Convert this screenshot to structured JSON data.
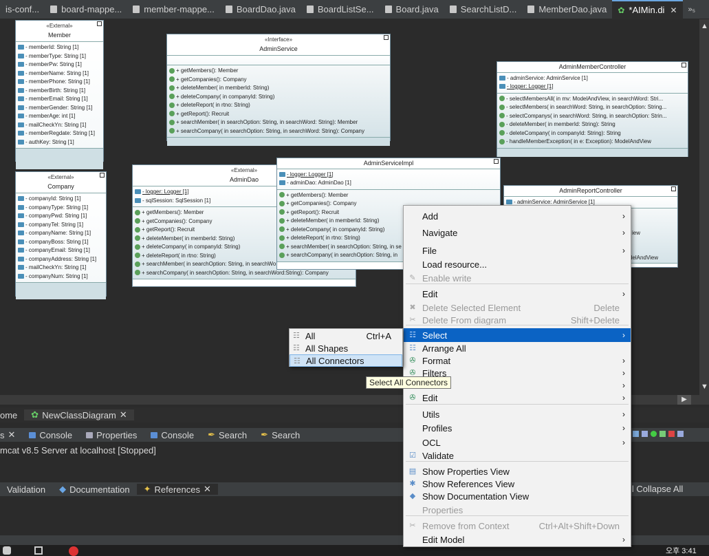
{
  "tabs": [
    {
      "label": "is-conf...",
      "active": false
    },
    {
      "label": "board-mappe...",
      "active": false
    },
    {
      "label": "member-mappe...",
      "active": false
    },
    {
      "label": "BoardDao.java",
      "active": false
    },
    {
      "label": "BoardListSe...",
      "active": false
    },
    {
      "label": "Board.java",
      "active": false
    },
    {
      "label": "SearchListD...",
      "active": false
    },
    {
      "label": "MemberDao.java",
      "active": false
    },
    {
      "label": "*AIMin.di",
      "active": true
    }
  ],
  "tabs_overflow": "»₅",
  "uml": {
    "member": {
      "stereotype": "«External»",
      "name": "Member",
      "attrs": [
        "- memberId: String [1]",
        "- memberType: String [1]",
        "- memberPw: String [1]",
        "- memberName: String [1]",
        "- memberPhone: String [1]",
        "- memberBirth: String [1]",
        "- memberEmail: String [1]",
        "- memberGender: String [1]",
        "- memberAge: int [1]",
        "- mailCheckYn: String [1]",
        "- memberRegdate: String [1]",
        "- authKey: String [1]"
      ]
    },
    "company": {
      "stereotype": "«External»",
      "name": "Company",
      "attrs": [
        "- companyId: String [1]",
        "- companyType: String [1]",
        "- companyPwd: String [1]",
        "- companyTel: String [1]",
        "- companyName: String [1]",
        "- companyBoss: String [1]",
        "- companyEmail: String [1]",
        "- companyAddress: String [1]",
        "- mailCheckYn: String [1]",
        "- companyNum: String [1]"
      ]
    },
    "admin_service": {
      "stereotype": "«Interface»",
      "name": "AdminService",
      "ops": [
        "+ getMembers(): Member",
        "+ getCompanies(): Company",
        "+ deleteMember(  in memberId: String)",
        "+ deleteCompany(  in companyId: String)",
        "+ deleteReport(  in rtno: String)",
        "+ getReport(): Recruit",
        "+ searchMember(  in searchOption: String,   in searchWord: String): Member",
        "+ searchCompany(  in searchOption: String,   in searchWord: String): Company"
      ]
    },
    "admin_dao": {
      "stereotype": "«External»",
      "name": "AdminDao",
      "attrs": [
        "- logger: Logger [1]",
        "- sqlSession: SqlSession [1]"
      ],
      "ops": [
        "+ getMembers(): Member",
        "+ getCompanies(): Company",
        "+ getReport(): Recruit",
        "+ deleteMember(  in memberId: String)",
        "+ deleteCompany(  in companyId: String)",
        "+ deleteReport(  in rtno: String)",
        "+ searchMember(  in searchOption: String,   in searchWo",
        "+ searchCompany(  in searchOption: String,   in searchWord:String): Company"
      ]
    },
    "admin_service_impl": {
      "name": "AdminServiceImpl",
      "attrs": [
        "- logger: Logger [1]",
        "- adminDao: AdminDao [1]"
      ],
      "ops": [
        "+ getMembers(): Member",
        "+ getCompanies(): Company",
        "+ getReport(): Recruit",
        "+ deleteMember(  in memberId: String)",
        "+ deleteCompany(  in companyId: String)",
        "+ deleteReport(  in rtno: String)",
        "+ searchMember(  in searchOption: String,   in se",
        "+ searchCompany(  in searchOption: String,   in"
      ]
    },
    "admin_member_controller": {
      "name": "AdminMemberController",
      "attrs": [
        "- adminService: AdminService [1]",
        "- logger: Logger [1]"
      ],
      "ops": [
        "- selectMembersAll(  in mv: ModelAndView,   in searchWord: Stri...",
        "- selectMembers(  in searchWord: String,   in searchOption: String...",
        "- selectCompanys(  in searchWord: String,   in searchOption: Strin...",
        "- deleteMember(  in memberId: String): String",
        "- deleteCompany(  in companyId: String): String",
        "- handleMemberException(  in e: Exception): ModelAndView"
      ]
    },
    "admin_report_controller": {
      "name": "AdminReportController",
      "attrs": [
        "- adminService: AdminService [1]"
      ],
      "ops_visible": [
        "iew",
        "delAndView"
      ]
    }
  },
  "context_menu": {
    "items": [
      {
        "label": "Add",
        "arrow": true
      },
      {
        "label": "Navigate",
        "arrow": true
      },
      {
        "label": "File",
        "arrow": true
      },
      {
        "label": "Load resource..."
      },
      {
        "label": "Enable write",
        "disabled": true
      },
      {
        "label": "Edit",
        "arrow": true
      },
      {
        "label": "Delete Selected Element",
        "accel": "Delete",
        "disabled": true
      },
      {
        "label": "Delete From diagram",
        "accel": "Shift+Delete",
        "disabled": true
      },
      {
        "label": "Select",
        "arrow": true,
        "selected": true
      },
      {
        "label": "Arrange All"
      },
      {
        "label": "Format",
        "arrow": true
      },
      {
        "label": "Filters",
        "arrow": true
      },
      {
        "label": "on",
        "arrow": true
      },
      {
        "label": "Edit",
        "arrow": true
      },
      {
        "label": "Utils",
        "arrow": true
      },
      {
        "label": "Profiles",
        "arrow": true
      },
      {
        "label": "OCL",
        "arrow": true
      },
      {
        "label": "Validate"
      },
      {
        "label": "Show Properties View"
      },
      {
        "label": "Show References View"
      },
      {
        "label": "Show Documentation View"
      },
      {
        "label": "Properties",
        "disabled": true
      },
      {
        "label": "Remove from Context",
        "accel": "Ctrl+Alt+Shift+Down",
        "disabled": true
      },
      {
        "label": "Edit Model",
        "arrow": true
      }
    ]
  },
  "submenu": {
    "items": [
      {
        "label": "All",
        "accel": "Ctrl+A"
      },
      {
        "label": "All Shapes"
      },
      {
        "label": "All Connectors",
        "selected": true
      }
    ]
  },
  "tooltip": "Select All Connectors",
  "bottom": {
    "editor_tabs": [
      {
        "label": "ome"
      },
      {
        "label": "NewClassDiagram"
      }
    ],
    "view_tabs": [
      {
        "label": "s"
      },
      {
        "label": "Console"
      },
      {
        "label": "Properties"
      },
      {
        "label": "Console"
      },
      {
        "label": "Search"
      },
      {
        "label": "Search"
      }
    ],
    "server_line": "mcat v8.5 Server at localhost  [Stopped]",
    "ref_tabs": [
      {
        "label": "Validation"
      },
      {
        "label": "Documentation"
      },
      {
        "label": "References"
      }
    ],
    "collapse_all": "ll  Collapse All",
    "clock": "오후 3:41"
  },
  "colors": {
    "menu_selected": "#0b63c4",
    "submenu_selected": "#cfe3f6",
    "canvas_bg": "#2b2b2b"
  }
}
